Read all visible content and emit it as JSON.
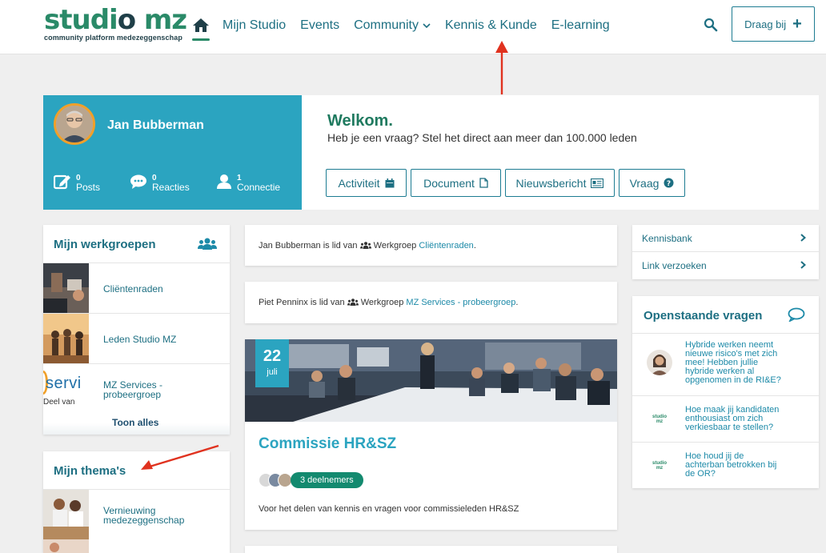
{
  "header": {
    "logo_main_a": "studi",
    "logo_main_b": "o",
    "logo_main_c": " mz",
    "logo_sub": "community platform medezeggenschap",
    "nav": [
      {
        "label": "Mijn Studio"
      },
      {
        "label": "Events"
      },
      {
        "label": "Community"
      },
      {
        "label": "Kennis & Kunde"
      },
      {
        "label": "E-learning"
      }
    ],
    "cta_label": "Draag bij",
    "cta_plus": "+"
  },
  "profile": {
    "name": "Jan Bubberman",
    "stats": [
      {
        "num": "0",
        "label": "Posts"
      },
      {
        "num": "0",
        "label": "Reacties"
      },
      {
        "num": "1",
        "label": "Connectie"
      }
    ]
  },
  "welcome": {
    "title": "Welkom.",
    "subtitle": "Heb je een vraag? Stel het direct aan meer dan 100.000 leden",
    "buttons": [
      {
        "label": "Activiteit"
      },
      {
        "label": "Document"
      },
      {
        "label": "Nieuwsbericht"
      },
      {
        "label": "Vraag"
      }
    ]
  },
  "werkgroepen": {
    "title": "Mijn werkgroepen",
    "items": [
      {
        "label": "Cliëntenraden"
      },
      {
        "label": "Leden Studio MZ"
      },
      {
        "label_1": "MZ Services -",
        "label_2": "probeergroep",
        "thumb_text_1": "servi",
        "thumb_text_2": "Deel van"
      }
    ],
    "show_all": "Toon alles"
  },
  "themas": {
    "title": "Mijn thema's",
    "items": [
      {
        "label_1": "Vernieuwing",
        "label_2": "medezeggenschap"
      }
    ]
  },
  "feed": {
    "items": [
      {
        "person": "Jan Bubberman",
        "mid": " is lid van ",
        "group_word": " Werkgroep ",
        "group": "Cliëntenraden",
        "end": "."
      },
      {
        "person": "Piet Penninx",
        "mid": " is lid van ",
        "group_word": " Werkgroep ",
        "group": "MZ Services - probeergroep",
        "end": "."
      }
    ],
    "event": {
      "day": "22",
      "month": "juli",
      "title": "Commissie HR&SZ",
      "participants": "3 deelnemers",
      "description": "Voor het delen van kennis en vragen voor commissieleden HR&SZ"
    }
  },
  "sidelinks": [
    {
      "label": "Kennisbank"
    },
    {
      "label": "Link verzoeken"
    }
  ],
  "questions": {
    "title": "Openstaande vragen",
    "items": [
      {
        "lines": [
          "Hybride werken neemt",
          "nieuwe risico's met zich",
          "mee! Hebben jullie",
          "hybride werken al",
          "opgenomen in de RI&E?"
        ]
      },
      {
        "lines": [
          "Hoe maak jij kandidaten",
          "enthousiast om zich",
          "verkiesbaar te stellen?"
        ],
        "logo": "studio mz"
      },
      {
        "lines": [
          "Hoe houd jij de",
          "achterban betrokken bij",
          "de OR?"
        ],
        "logo": "studio mz"
      }
    ]
  },
  "colors": {
    "brand_green": "#2a8a68",
    "brand_teal": "#2ba4c0",
    "link": "#1d6f82",
    "badge": "#138a6f",
    "annotation_arrow": "#e0321f"
  }
}
